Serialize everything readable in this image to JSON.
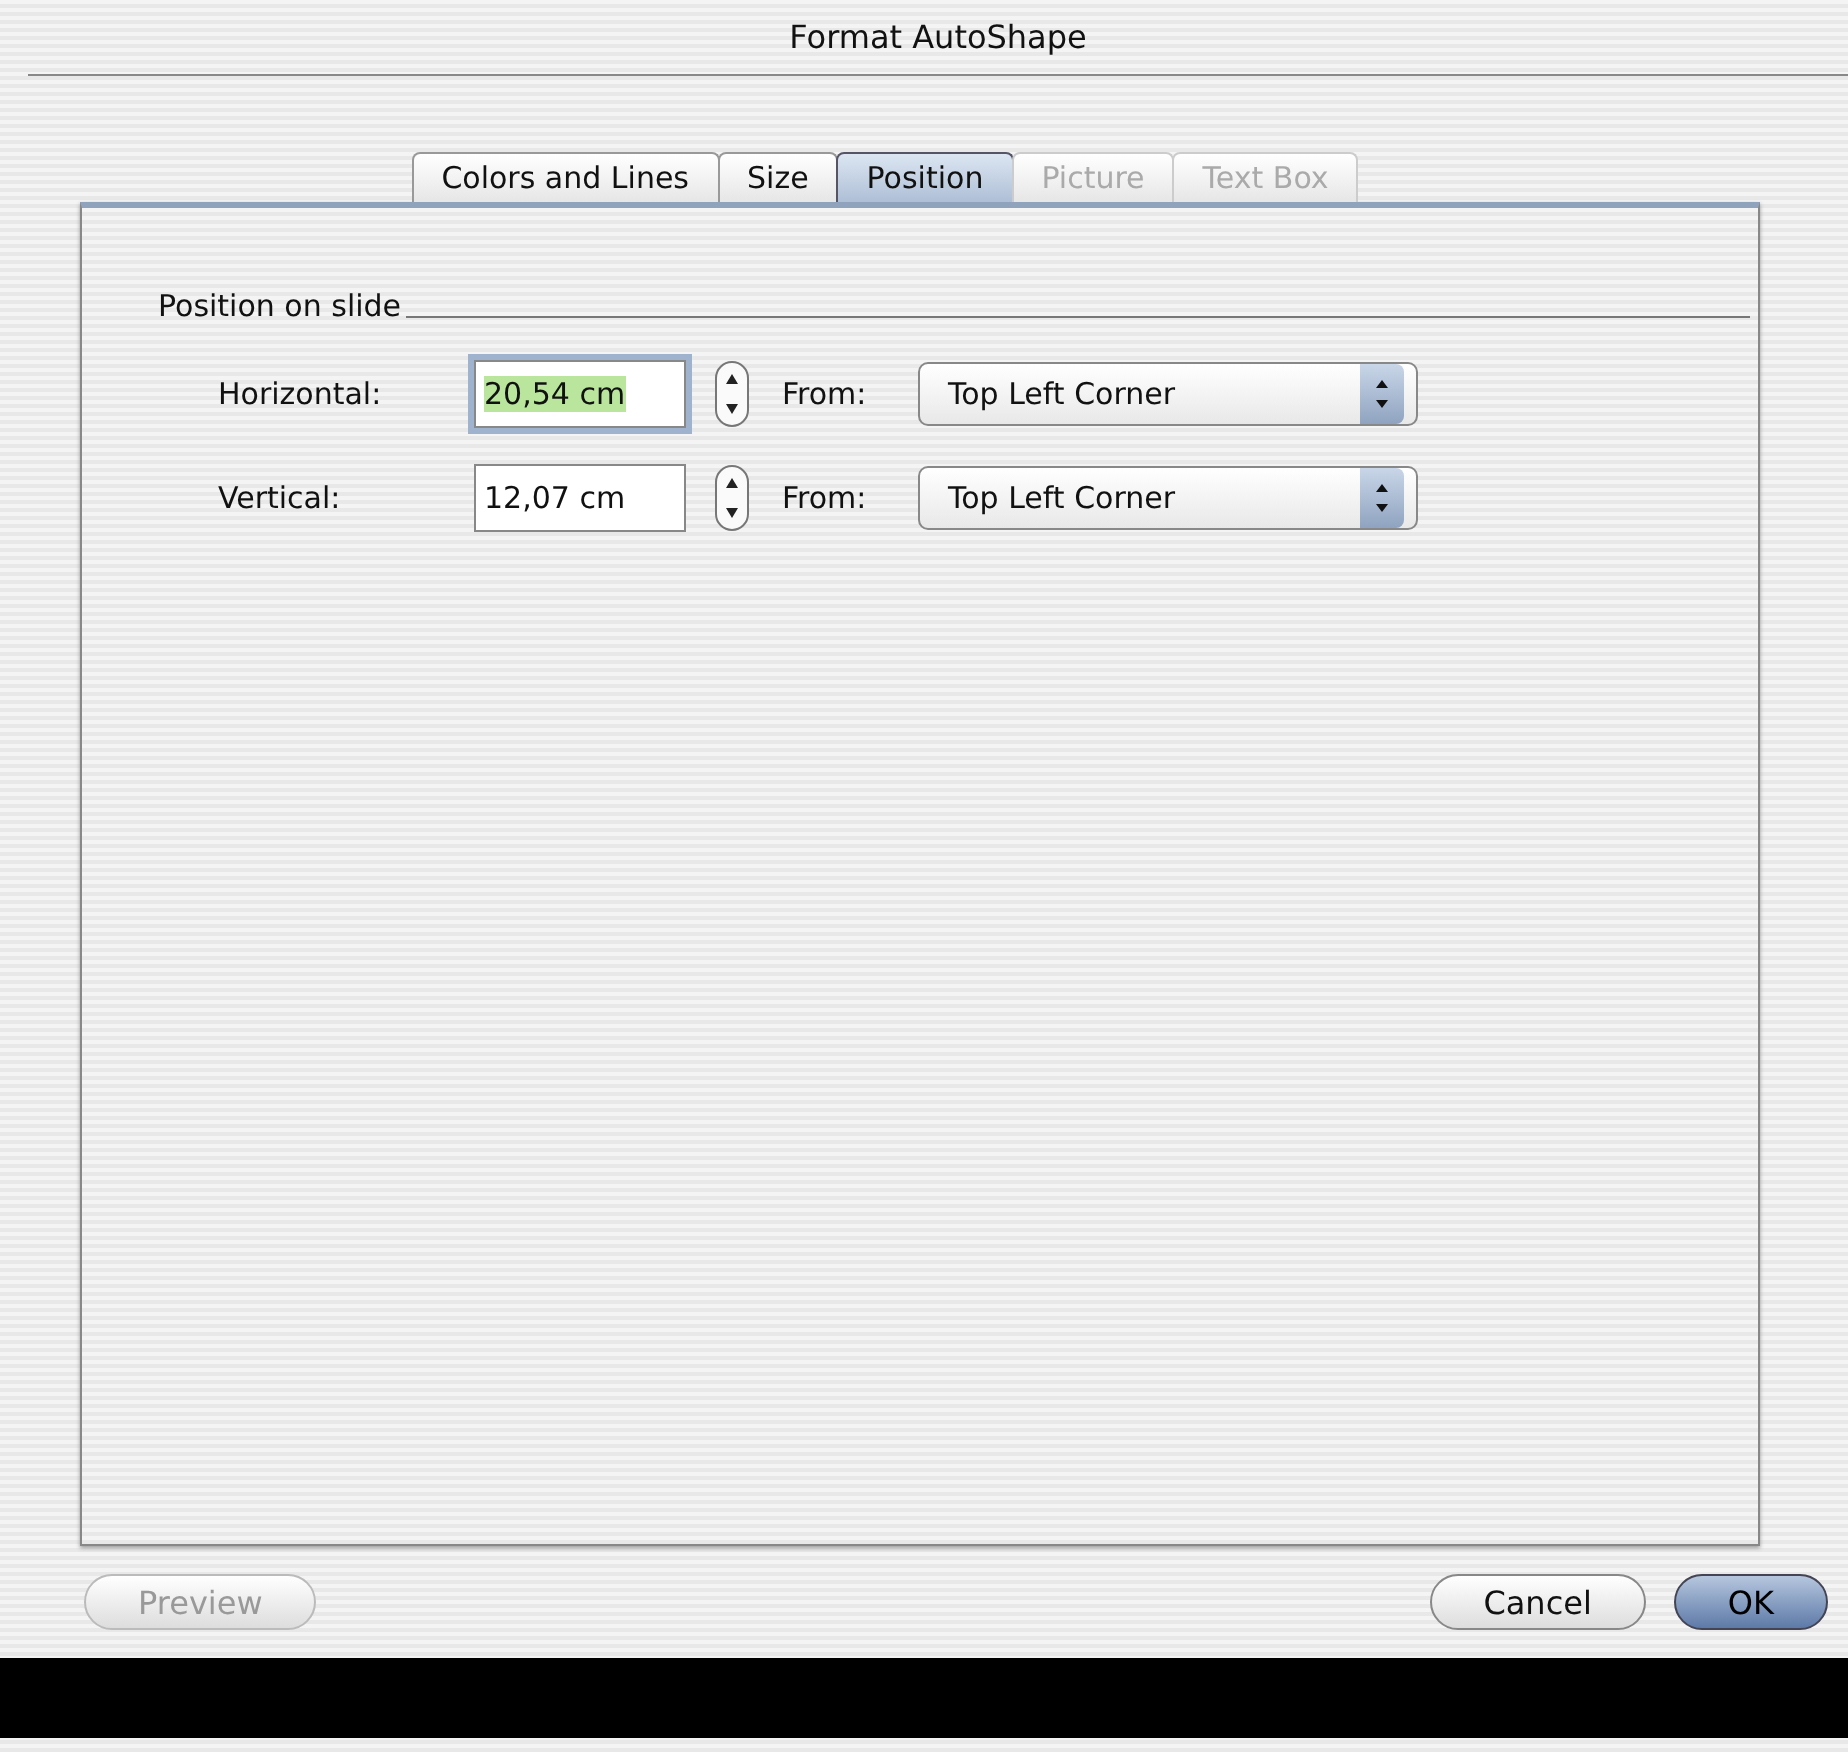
{
  "window": {
    "title": "Format AutoShape"
  },
  "tabs": [
    {
      "label": "Colors and Lines",
      "selected": false,
      "disabled": false
    },
    {
      "label": "Size",
      "selected": false,
      "disabled": false
    },
    {
      "label": "Position",
      "selected": true,
      "disabled": false
    },
    {
      "label": "Picture",
      "selected": false,
      "disabled": true
    },
    {
      "label": "Text Box",
      "selected": false,
      "disabled": true
    }
  ],
  "group": {
    "title": "Position on slide",
    "rows": [
      {
        "label": "Horizontal:",
        "value": "20,54 cm",
        "focused": true,
        "from_label": "From:",
        "from_value": "Top Left Corner"
      },
      {
        "label": "Vertical:",
        "value": "12,07 cm",
        "focused": false,
        "from_label": "From:",
        "from_value": "Top Left Corner"
      }
    ]
  },
  "buttons": [
    {
      "label": "Preview",
      "disabled": true,
      "default": false
    },
    {
      "label": "Cancel",
      "disabled": false,
      "default": false
    },
    {
      "label": "OK",
      "disabled": false,
      "default": true
    }
  ]
}
